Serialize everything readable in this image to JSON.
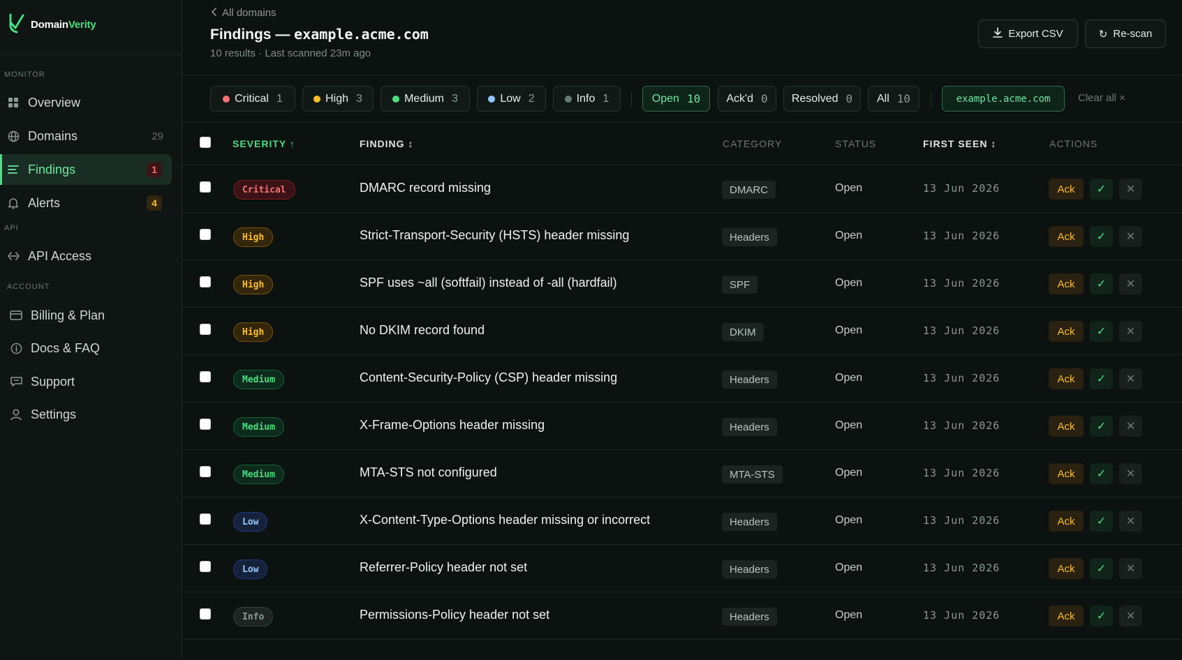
{
  "app": {
    "brand_prefix": "Domain",
    "brand_suffix": "Verity"
  },
  "sidebar": {
    "sections": {
      "monitor": "MONITOR",
      "api": "API",
      "account": "ACCOUNT"
    },
    "items": [
      {
        "label": "Overview",
        "icon": "grid-icon"
      },
      {
        "label": "Domains",
        "icon": "globe-icon",
        "count": "29"
      },
      {
        "label": "Findings",
        "icon": "list-icon",
        "badge": "1",
        "active": true
      },
      {
        "label": "Alerts",
        "icon": "bell-icon",
        "badge": "4"
      },
      {
        "label": "API Access",
        "icon": "code-arrows-icon"
      },
      {
        "label": "Billing & Plan",
        "icon": "credit-card-icon"
      },
      {
        "label": "Docs & FAQ",
        "icon": "info-circle-icon"
      },
      {
        "label": "Support",
        "icon": "chat-icon"
      },
      {
        "label": "Settings",
        "icon": "user-icon"
      }
    ]
  },
  "header": {
    "back": "All domains",
    "title_prefix": "Findings — ",
    "title_domain": "example.acme.com",
    "subtitle": "10 results · Last scanned 23m ago",
    "export": "Export CSV",
    "rescan": "Re-scan"
  },
  "filters": {
    "severity": [
      {
        "label": "Critical",
        "count": "1",
        "color": "#f87171"
      },
      {
        "label": "High",
        "count": "3",
        "color": "#fbbf24"
      },
      {
        "label": "Medium",
        "count": "3",
        "color": "#4ade80"
      },
      {
        "label": "Low",
        "count": "2",
        "color": "#93c5fd"
      },
      {
        "label": "Info",
        "count": "1",
        "color": "#6b7a75"
      }
    ],
    "status": [
      {
        "label": "Open",
        "count": "10",
        "active": true
      },
      {
        "label": "Ack'd",
        "count": "0"
      },
      {
        "label": "Resolved",
        "count": "0"
      },
      {
        "label": "All",
        "count": "10"
      }
    ],
    "domain": "example.acme.com",
    "clear": "Clear all ×"
  },
  "table": {
    "columns": {
      "severity": "SEVERITY ↑",
      "finding": "FINDING ↕",
      "category": "CATEGORY",
      "status": "STATUS",
      "first_seen": "FIRST SEEN ↕",
      "actions": "ACTIONS"
    },
    "action_labels": {
      "ack": "Ack",
      "resolve": "✓",
      "dismiss": "✕"
    },
    "rows": [
      {
        "severity": "Critical",
        "finding": "DMARC record missing",
        "category": "DMARC",
        "status": "Open",
        "first_seen": "13 Jun 2026"
      },
      {
        "severity": "High",
        "finding": "Strict-Transport-Security (HSTS) header missing",
        "category": "Headers",
        "status": "Open",
        "first_seen": "13 Jun 2026"
      },
      {
        "severity": "High",
        "finding": "SPF uses ~all (softfail) instead of -all (hardfail)",
        "category": "SPF",
        "status": "Open",
        "first_seen": "13 Jun 2026"
      },
      {
        "severity": "High",
        "finding": "No DKIM record found",
        "category": "DKIM",
        "status": "Open",
        "first_seen": "13 Jun 2026"
      },
      {
        "severity": "Medium",
        "finding": "Content-Security-Policy (CSP) header missing",
        "category": "Headers",
        "status": "Open",
        "first_seen": "13 Jun 2026"
      },
      {
        "severity": "Medium",
        "finding": "X-Frame-Options header missing",
        "category": "Headers",
        "status": "Open",
        "first_seen": "13 Jun 2026"
      },
      {
        "severity": "Medium",
        "finding": "MTA-STS not configured",
        "category": "MTA-STS",
        "status": "Open",
        "first_seen": "13 Jun 2026"
      },
      {
        "severity": "Low",
        "finding": "X-Content-Type-Options header missing or incorrect",
        "category": "Headers",
        "status": "Open",
        "first_seen": "13 Jun 2026"
      },
      {
        "severity": "Low",
        "finding": "Referrer-Policy header not set",
        "category": "Headers",
        "status": "Open",
        "first_seen": "13 Jun 2026"
      },
      {
        "severity": "Info",
        "finding": "Permissions-Policy header not set",
        "category": "Headers",
        "status": "Open",
        "first_seen": "13 Jun 2026"
      }
    ]
  }
}
